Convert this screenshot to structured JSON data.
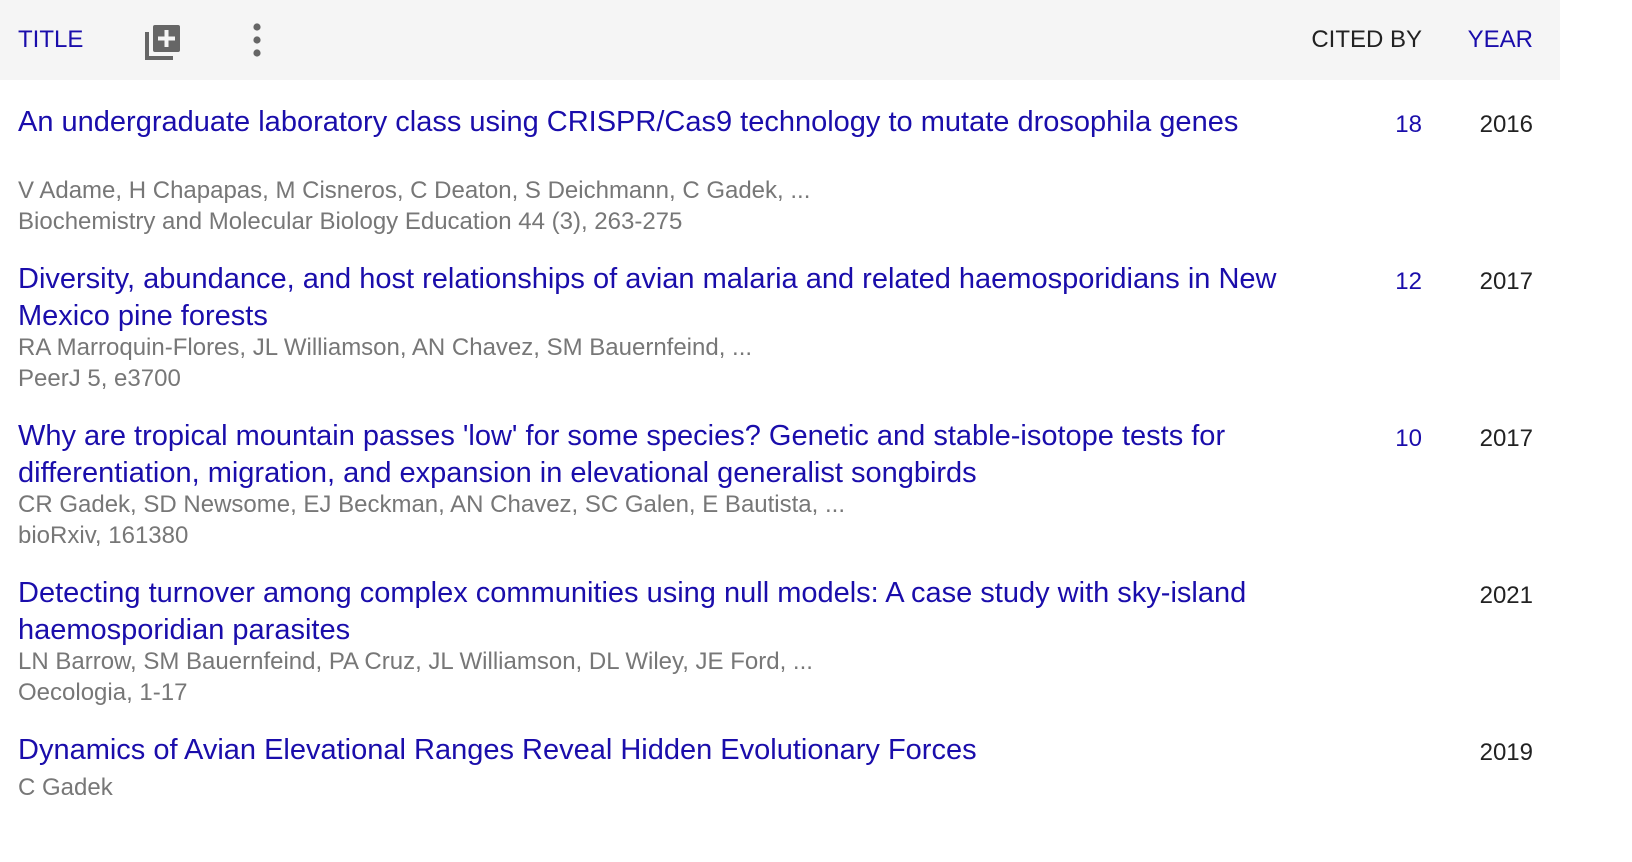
{
  "header": {
    "title_label": "TITLE",
    "cited_by_label": "CITED BY",
    "year_label": "YEAR"
  },
  "icons": {
    "add": "library-add-icon",
    "more": "more-vertical-icon"
  },
  "colors": {
    "link": "#1a0dab",
    "meta": "#777777",
    "header_bg": "#f5f5f5"
  },
  "publications": [
    {
      "title": "An undergraduate laboratory class using CRISPR/Cas9 technology to mutate drosophila genes",
      "authors": "V Adame, H Chapapas, M Cisneros, C Deaton, S Deichmann, C Gadek, ...",
      "venue": "Biochemistry and Molecular Biology Education 44 (3), 263-275",
      "cited_by": "18",
      "year": "2016"
    },
    {
      "title": "Diversity, abundance, and host relationships of avian malaria and related haemosporidians in New Mexico pine forests",
      "authors": "RA Marroquin-Flores, JL Williamson, AN Chavez, SM Bauernfeind, ...",
      "venue": "PeerJ 5, e3700",
      "cited_by": "12",
      "year": "2017"
    },
    {
      "title": "Why are tropical mountain passes 'low' for some species? Genetic and stable-isotope tests for differentiation, migration, and expansion in elevational generalist songbirds",
      "authors": "CR Gadek, SD Newsome, EJ Beckman, AN Chavez, SC Galen, E Bautista, ...",
      "venue": "bioRxiv, 161380",
      "cited_by": "10",
      "year": "2017"
    },
    {
      "title": "Detecting turnover among complex communities using null models: A case study with sky-island haemosporidian parasites",
      "authors": "LN Barrow, SM Bauernfeind, PA Cruz, JL Williamson, DL Wiley, JE Ford, ...",
      "venue": "Oecologia, 1-17",
      "cited_by": "",
      "year": "2021"
    },
    {
      "title": "Dynamics of Avian Elevational Ranges Reveal Hidden Evolutionary Forces",
      "authors": "C Gadek",
      "venue": "",
      "cited_by": "",
      "year": "2019"
    }
  ]
}
